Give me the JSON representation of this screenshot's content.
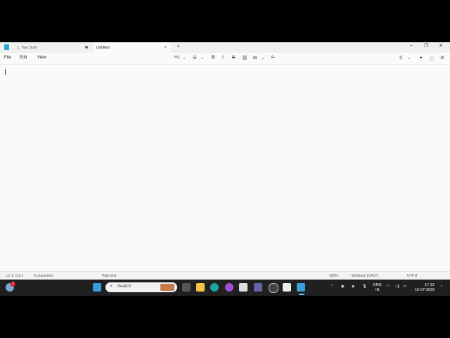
{
  "tabs": [
    {
      "label": "1. Two Sum"
    },
    {
      "label": "Untitled",
      "close": "×"
    }
  ],
  "new_tab": "+",
  "window_controls": {
    "minimize": "–",
    "maximize": "❐",
    "close": "✕"
  },
  "menu": {
    "file": "File",
    "edit": "Edit",
    "view": "View"
  },
  "toolbar": {
    "heading": "H1",
    "list": "☰",
    "bold": "B",
    "italic": "I",
    "strike": "S",
    "link": "⛓",
    "table": "⊞",
    "clear": "A̶"
  },
  "status": {
    "position": "Ln 1, Col 1",
    "characters": "0 characters",
    "format": "Plain text",
    "zoom": "100%",
    "line_ending": "Windows (CRLF)",
    "encoding": "UTF-8"
  },
  "taskbar": {
    "search_label": "Search",
    "weather_badge": "2",
    "lang_line1": "ENG",
    "lang_line2": "IN",
    "time": "17:12",
    "date": "16-07-2025"
  },
  "colors": {
    "accent": "#0067c0",
    "taskbar": "#202020"
  }
}
